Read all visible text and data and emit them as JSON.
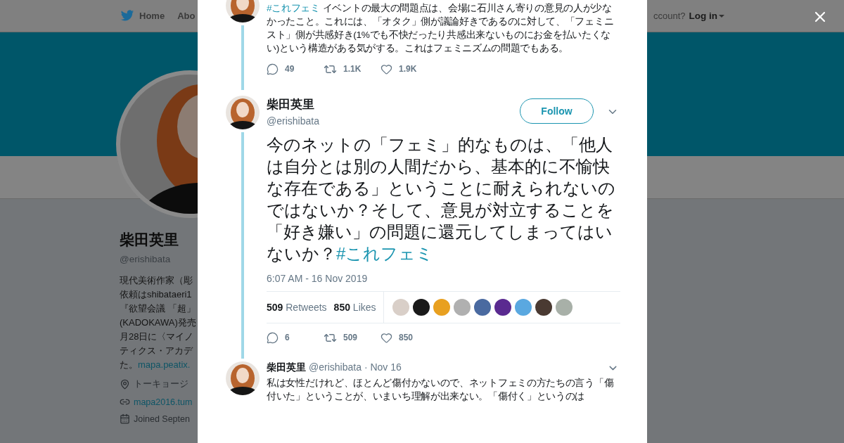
{
  "page": {
    "nav": [
      {
        "label": "Home",
        "kind": "home"
      },
      {
        "label": "Abo",
        "kind": "plain"
      }
    ],
    "account_prompt": "ccount?",
    "login": "Log in",
    "profile": {
      "name": "柴田英里",
      "handle": "@erishibata",
      "bio_lines": [
        "現代美術作家（彫",
        "依頼はshibataeri1",
        "『欲望会議 「超」",
        "(KADOKAWA)発売",
        "月28日に〈マイノ",
        "ティクス・アカデ"
      ],
      "bio_last": "た。",
      "bio_link": "mapa.peatix.",
      "location": "トーキョージ",
      "website": "mapa2016.tum",
      "joined": "Joined Septen"
    }
  },
  "modal": {
    "tweets": [
      {
        "kind": "context",
        "hashtag": "#これフェミ",
        "text": "イベントの最大の問題点は、会場に石川さん寄りの意見の人が少なかったこと。これには、「オタク」側が議論好きであるのに対して、「フェミニスト」側が共感好き(1%でも不快だったり共感出来ないものにお金を払いたくない)という構造がある気がする。これはフェミニズムの問題でもある。",
        "actions": {
          "replies": "49",
          "retweets": "1.1K",
          "likes": "1.9K"
        }
      },
      {
        "kind": "focused",
        "name": "柴田英里",
        "handle": "@erishibata",
        "follow": "Follow",
        "text": "今のネットの「フェミ」的なものは、「他人は自分とは別の人間だから、基本的に不愉快な存在である」ということに耐えられないのではないか？そして、意見が対立することを「好き嫌い」の問題に還元してしまってはいないか？",
        "hashtag": "#これフェミ",
        "time": "6:07 AM - 16 Nov 2019",
        "retweet_count": "509",
        "retweet_label": "Retweets",
        "like_count": "850",
        "like_label": "Likes",
        "likers": [
          {
            "color": "#d9cfc8"
          },
          {
            "color": "#1a1a1a"
          },
          {
            "color": "#e8a020"
          },
          {
            "color": "#b0b0b0"
          },
          {
            "color": "#4a6aa0"
          },
          {
            "color": "#5a2a90"
          },
          {
            "color": "#5aa8e0"
          },
          {
            "color": "#4a3a32"
          },
          {
            "color": "#a8b0a8"
          }
        ],
        "actions": {
          "replies": "6",
          "retweets": "509",
          "likes": "850"
        }
      },
      {
        "kind": "reply",
        "name": "柴田英里",
        "handle": "@erishibata",
        "date": "· Nov 16",
        "text": "私は女性だけれど、ほとんど傷付かないので、ネットフェミの方たちの言う「傷付いた」ということが、いまいち理解が出来ない。「傷付く」というのは"
      }
    ]
  }
}
